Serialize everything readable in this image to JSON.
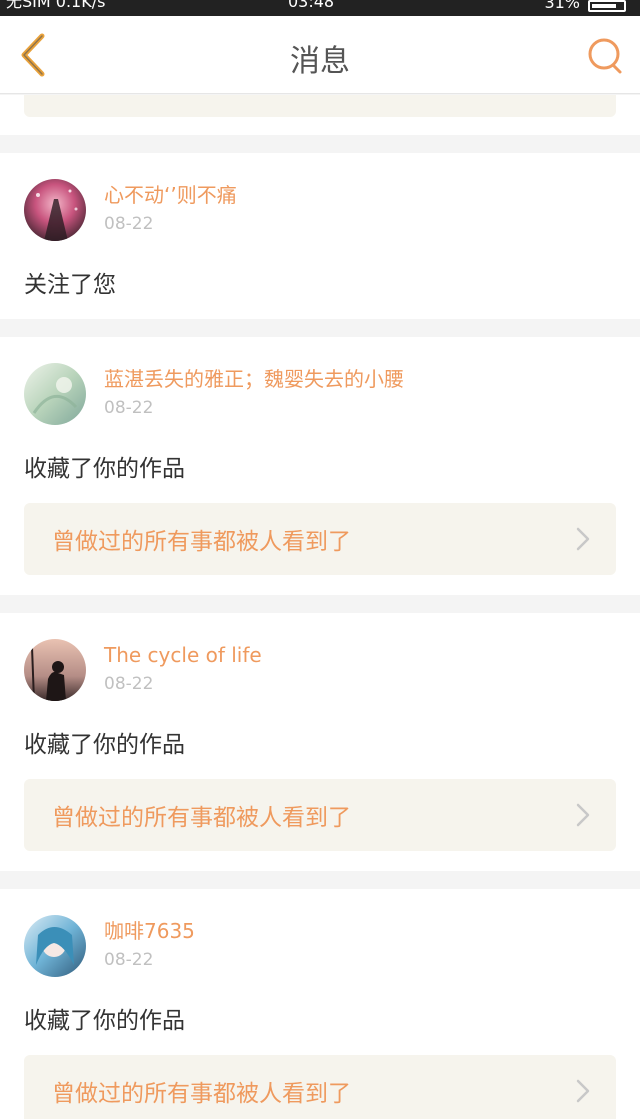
{
  "status_bar": {
    "carrier": "无SIM 0.1K/s",
    "time": "03:48",
    "battery": "31%"
  },
  "header": {
    "title": "消息",
    "back_icon": "chevron-left-icon",
    "search_icon": "search-icon",
    "accent_color": "#e9a23b"
  },
  "notifications": [
    {
      "username": "心不动‘’则不痛",
      "date": "08-22",
      "action": "关注了您",
      "avatar_colors": [
        "#2b1c22",
        "#c8547e"
      ]
    },
    {
      "username": "蓝湛丢失的雅正；魏婴失去的小腰",
      "date": "08-22",
      "action": "收藏了你的作品",
      "work_title": "曾做过的所有事都被人看到了",
      "avatar_colors": [
        "#d8e6d6",
        "#9fc3a5"
      ]
    },
    {
      "username": "The cycle of life",
      "date": "08-22",
      "action": "收藏了你的作品",
      "work_title": "曾做过的所有事都被人看到了",
      "avatar_colors": [
        "#3a2a2a",
        "#e6b6a3"
      ]
    },
    {
      "username": "咖啡7635",
      "date": "08-22",
      "action": "收藏了你的作品",
      "work_title": "曾做过的所有事都被人看到了",
      "avatar_colors": [
        "#2f5a7a",
        "#9dd0e8"
      ]
    }
  ]
}
